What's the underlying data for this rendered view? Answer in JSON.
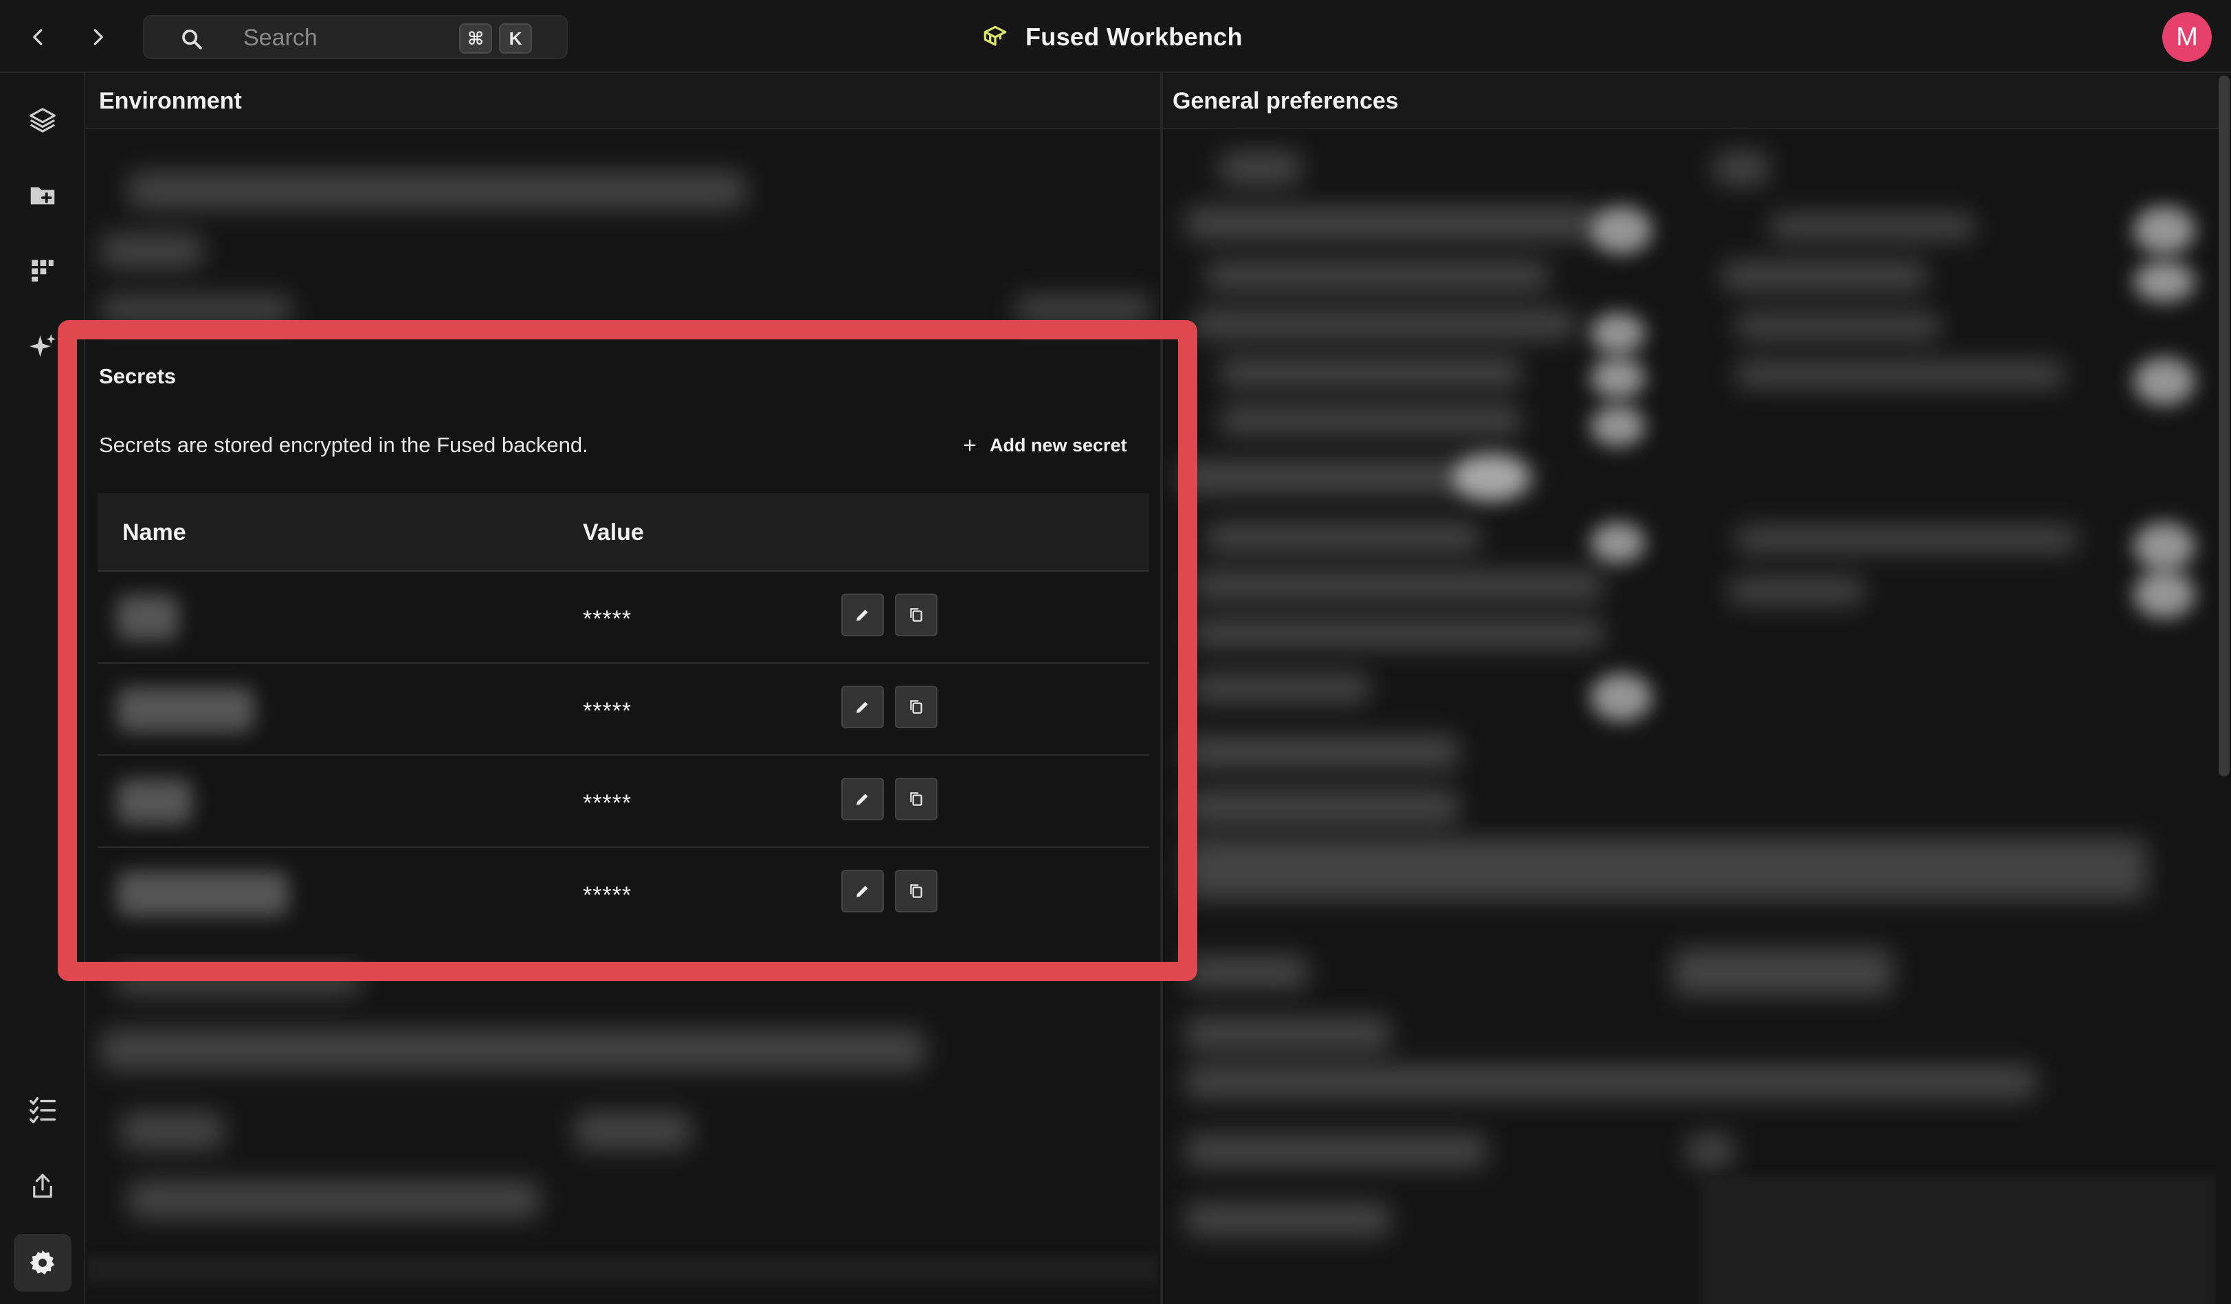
{
  "app": {
    "title": "Fused Workbench",
    "avatar_initial": "M"
  },
  "search": {
    "placeholder": "Search",
    "shortcut_mod": "⌘",
    "shortcut_key": "K"
  },
  "sidebar": {
    "items": [
      {
        "icon": "layers-icon"
      },
      {
        "icon": "folder-add-icon"
      },
      {
        "icon": "blocks-icon"
      },
      {
        "icon": "sparkle-icon"
      },
      {
        "icon": "checklist-icon"
      },
      {
        "icon": "share-icon"
      },
      {
        "icon": "gear-icon",
        "active": true
      }
    ]
  },
  "panels": {
    "left_title": "Environment",
    "right_title": "General preferences"
  },
  "secrets": {
    "title": "Secrets",
    "description": "Secrets are stored encrypted in the Fused backend.",
    "add_label": "Add new secret",
    "columns": {
      "name": "Name",
      "value": "Value"
    },
    "rows": [
      {
        "value": "*****"
      },
      {
        "value": "*****"
      },
      {
        "value": "*****"
      },
      {
        "value": "*****"
      }
    ]
  },
  "colors": {
    "highlight": "#e0484f",
    "avatar": "#e6406d",
    "logo": "#d9e36a"
  }
}
